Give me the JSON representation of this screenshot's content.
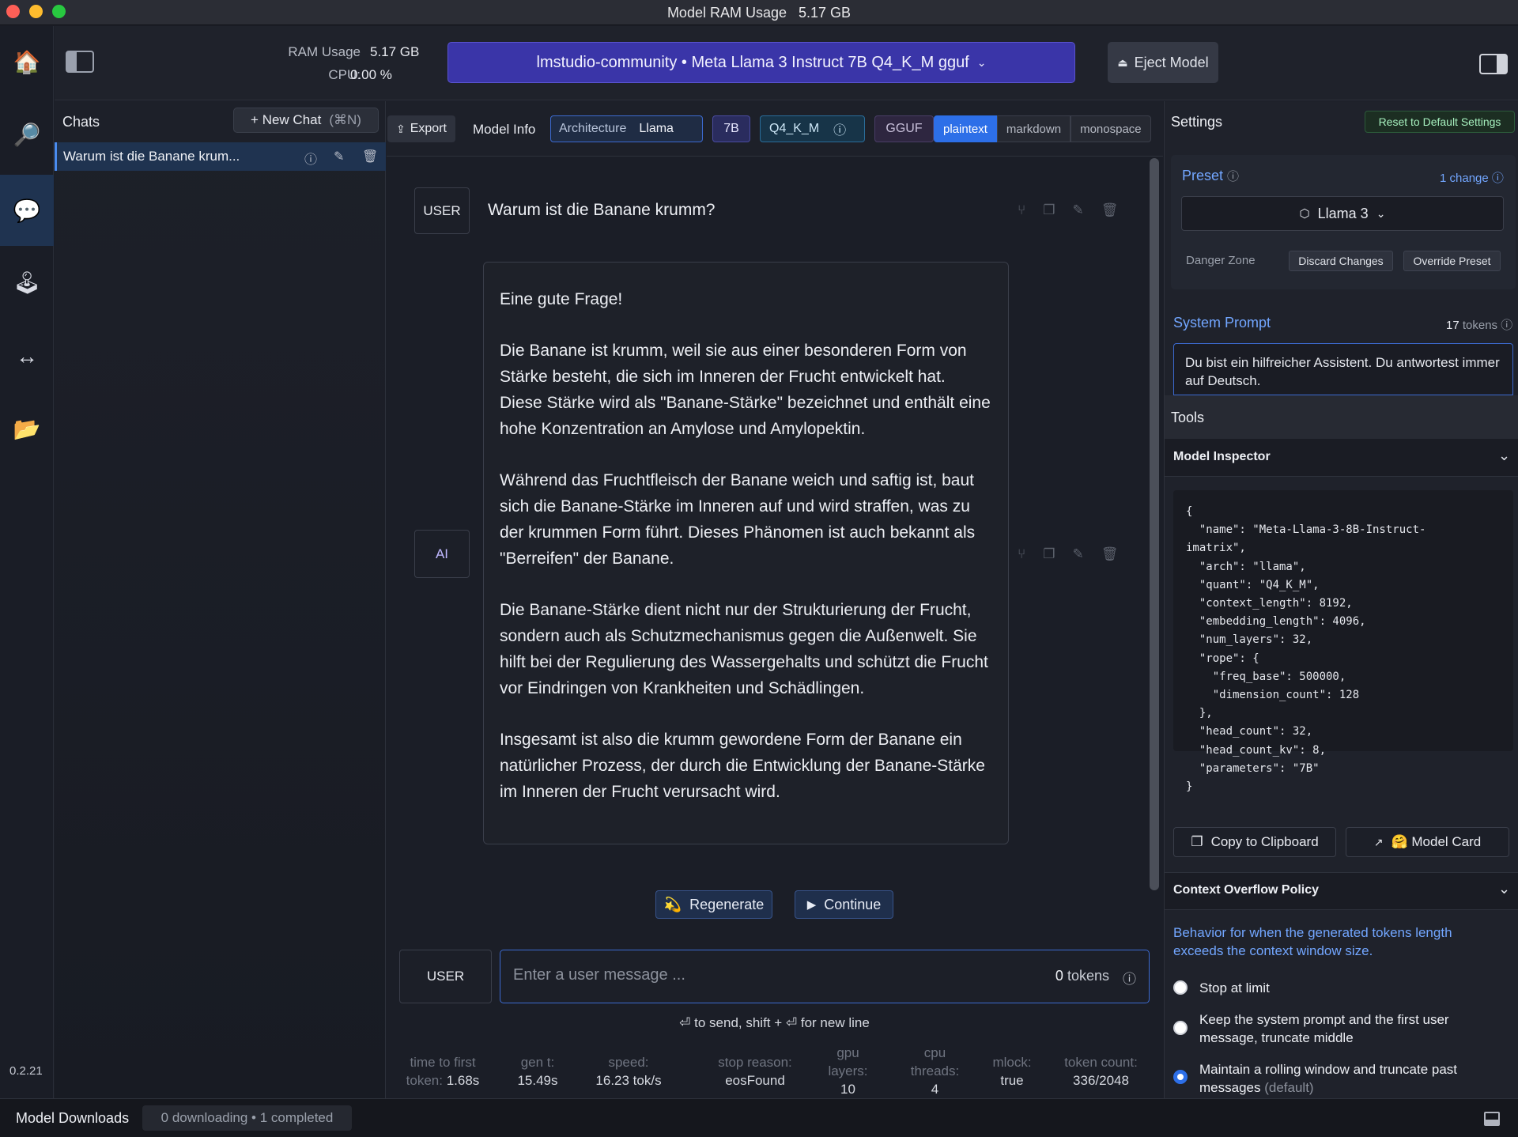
{
  "window": {
    "title": "Model RAM Usage   5.17 GB"
  },
  "rail": {
    "items": [
      {
        "icon": "home-icon",
        "glyph": "🏠"
      },
      {
        "icon": "search-icon",
        "glyph": "🔎"
      },
      {
        "icon": "chat-icon",
        "glyph": "💬"
      },
      {
        "icon": "joystick-icon",
        "glyph": "🕹"
      },
      {
        "icon": "arrows-icon",
        "glyph": "↔"
      },
      {
        "icon": "folder-icon",
        "glyph": "📂"
      }
    ],
    "version": "0.2.21"
  },
  "topbar": {
    "ram_label": "RAM Usage",
    "ram_value": "5.17 GB",
    "cpu_label": "CPU:",
    "cpu_value": "0.00 %",
    "model": "lmstudio-community • Meta Llama 3 Instruct 7B Q4_K_M gguf",
    "eject_label": "Eject Model"
  },
  "chats": {
    "title": "Chats",
    "new_chat": "+ New Chat",
    "new_chat_shortcut": "(⌘N)",
    "items": [
      {
        "label": "Warum ist die Banane krum..."
      }
    ]
  },
  "toolbar": {
    "export": "Export",
    "model_info": "Model Info",
    "architecture_label": "Architecture",
    "architecture_value": "Llama",
    "size": "7B",
    "quant": "Q4_K_M",
    "format": "GGUF",
    "modes": [
      "plaintext",
      "markdown",
      "monospace"
    ],
    "active_mode": "plaintext"
  },
  "conversation": {
    "user_role": "USER",
    "ai_role": "AI",
    "user_message": "Warum ist die Banane krumm?",
    "ai_paragraphs": [
      "Eine gute Frage!",
      "Die Banane ist krumm, weil sie aus einer besonderen Form von Stärke besteht, die sich im Inneren der Frucht entwickelt hat. Diese Stärke wird als \"Banane-Stärke\" bezeichnet und enthält eine hohe Konzentration an Amylose und Amylopektin.",
      "Während das Fruchtfleisch der Banane weich und saftig ist, baut sich die Banane-Stärke im Inneren auf und wird straffen, was zu der krummen Form führt. Dieses Phänomen ist auch bekannt als \"Berreifen\" der Banane.",
      "Die Banane-Stärke dient nicht nur der Strukturierung der Frucht, sondern auch als Schutzmechanismus gegen die Außenwelt. Sie hilft bei der Regulierung des Wassergehalts und schützt die Frucht vor Eindringen von Krankheiten und Schädlingen.",
      "Insgesamt ist also die krumm gewordene Form der Banane ein natürlicher Prozess, der durch die Entwicklung der Banane-Stärke im Inneren der Frucht verursacht wird."
    ],
    "regenerate": "Regenerate",
    "continue": "Continue"
  },
  "input": {
    "role": "USER",
    "placeholder": "Enter a user message ...",
    "value": "",
    "token_count": "0",
    "token_unit": "tokens",
    "hint": "⏎ to send, shift + ⏎ for new line"
  },
  "stats": [
    {
      "label": "time to first",
      "label2": "token:",
      "value": "1.68s"
    },
    {
      "label": "gen t:",
      "value": "15.49s"
    },
    {
      "label": "speed:",
      "value": "16.23 tok/s"
    },
    {
      "label": "stop reason:",
      "value": "eosFound"
    },
    {
      "label": "gpu",
      "label2": "layers:",
      "value": "10"
    },
    {
      "label": "cpu",
      "label2": "threads:",
      "value": "4"
    },
    {
      "label": "mlock:",
      "value": "true"
    },
    {
      "label": "token count:",
      "value": "336/2048"
    }
  ],
  "settings": {
    "title": "Settings",
    "reset": "Reset to Default Settings",
    "preset_label": "Preset",
    "preset_changes": "1 change",
    "preset_value": "Llama 3",
    "danger_zone": "Danger Zone",
    "discard": "Discard Changes",
    "override": "Override Preset",
    "system_prompt_label": "System Prompt",
    "system_prompt_tokens": "17",
    "system_prompt_tokens_unit": "tokens",
    "system_prompt": "Du bist ein hilfreicher Assistent. Du antwortest immer auf Deutsch.",
    "tools": "Tools",
    "model_inspector": "Model Inspector",
    "inspector_json": "{\n  \"name\": \"Meta-Llama-3-8B-Instruct-\nimatrix\",\n  \"arch\": \"llama\",\n  \"quant\": \"Q4_K_M\",\n  \"context_length\": 8192,\n  \"embedding_length\": 4096,\n  \"num_layers\": 32,\n  \"rope\": {\n    \"freq_base\": 500000,\n    \"dimension_count\": 128\n  },\n  \"head_count\": 32,\n  \"head_count_kv\": 8,\n  \"parameters\": \"7B\"\n}",
    "copy_clipboard": "Copy to Clipboard",
    "model_card": "🤗 Model Card",
    "overflow_title": "Context Overflow Policy",
    "overflow_desc": "Behavior for when the generated tokens length exceeds the context window size.",
    "overflow_options": [
      {
        "label": "Stop at limit",
        "selected": false
      },
      {
        "label": "Keep the system prompt and the first user message, truncate middle",
        "selected": false
      },
      {
        "label": "Maintain a rolling window and truncate past messages",
        "suffix": "(default)",
        "selected": true
      }
    ]
  },
  "bottombar": {
    "downloads_label": "Model Downloads",
    "downloads_status": "0 downloading • 1 completed"
  },
  "colors": {
    "accent": "#2d6fe8",
    "model_bar": "#3a35a8",
    "link": "#72a6ff"
  }
}
